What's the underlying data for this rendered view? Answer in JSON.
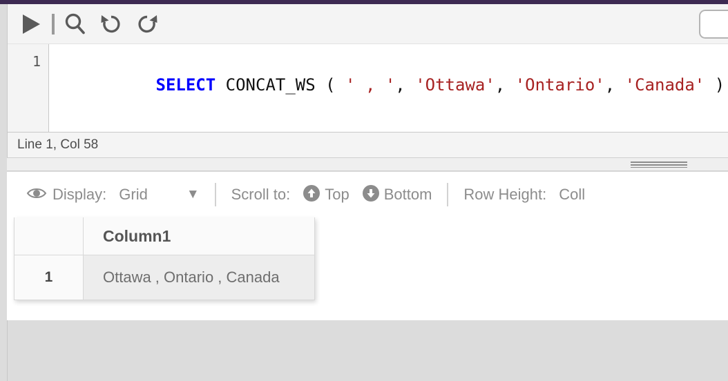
{
  "theme": {
    "accent_bar_color": "#3d2a52",
    "keyword_color": "#0000ff",
    "string_color": "#a72222",
    "canvas_color": "#dcdcdc"
  },
  "editor": {
    "toolbar": {
      "run_label": "Run",
      "run_icon": "play-icon",
      "search_icon": "search-icon",
      "undo_icon": "undo-icon",
      "redo_icon": "redo-icon",
      "search_input_value": "",
      "search_input_placeholder": ""
    },
    "line_number": "1",
    "code": {
      "full_text": "SELECT CONCAT_WS ( ' , ', 'Ottawa', 'Ontario', 'Canada' )",
      "tokens": [
        {
          "text": "SELECT",
          "type": "keyword"
        },
        {
          "text": " CONCAT_WS ( ",
          "type": "plain"
        },
        {
          "text": "' , '",
          "type": "string"
        },
        {
          "text": ", ",
          "type": "plain"
        },
        {
          "text": "'Ottawa'",
          "type": "string"
        },
        {
          "text": ", ",
          "type": "plain"
        },
        {
          "text": "'Ontario'",
          "type": "string"
        },
        {
          "text": ", ",
          "type": "plain"
        },
        {
          "text": "'Canada'",
          "type": "string"
        },
        {
          "text": " )",
          "type": "plain"
        }
      ]
    },
    "status": {
      "cursor_position": "Line 1, Col 58"
    }
  },
  "results": {
    "toolbar": {
      "display_icon": "eye-icon",
      "display_label": "Display:",
      "display_value": "Grid",
      "display_caret": "▼",
      "scroll_to_label": "Scroll to:",
      "scroll_top_label": "Top",
      "scroll_top_icon": "arrow-up-circle-icon",
      "scroll_bottom_label": "Bottom",
      "scroll_bottom_icon": "arrow-down-circle-icon",
      "row_height_label": "Row Height:",
      "row_height_value": "Coll"
    },
    "grid": {
      "row_number_header": "",
      "columns": [
        "Column1"
      ],
      "rows": [
        {
          "num": "1",
          "values": [
            "Ottawa , Ontario , Canada"
          ]
        }
      ]
    }
  }
}
